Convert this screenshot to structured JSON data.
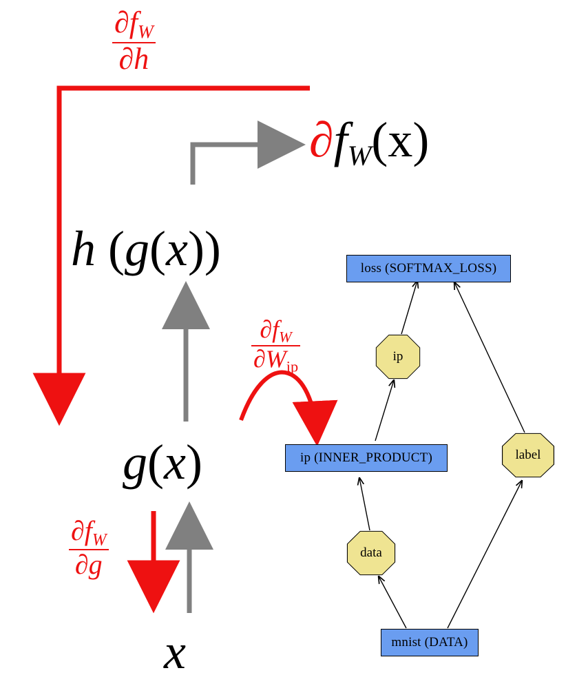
{
  "labels": {
    "dfdh": {
      "num": "∂f",
      "numsub": "W",
      "den": "∂h"
    },
    "dfdg": {
      "num": "∂f",
      "numsub": "W",
      "den": "∂g"
    },
    "dfdWip": {
      "num": "∂f",
      "numsub": "W",
      "den_prefix": "∂W",
      "den_sub": "ip"
    },
    "fWx": {
      "prefix": "∂",
      "body": "f",
      "sub": "W",
      "arg": "(x)"
    },
    "hgx": "h (g(x))",
    "gx": "g(x)",
    "x": "x"
  },
  "graph": {
    "loss": "loss (SOFTMAX_LOSS)",
    "ip_box": "ip (INNER_PRODUCT)",
    "mnist": "mnist (DATA)",
    "ip_octagon": "ip",
    "data_octagon": "data",
    "label_octagon": "label"
  }
}
